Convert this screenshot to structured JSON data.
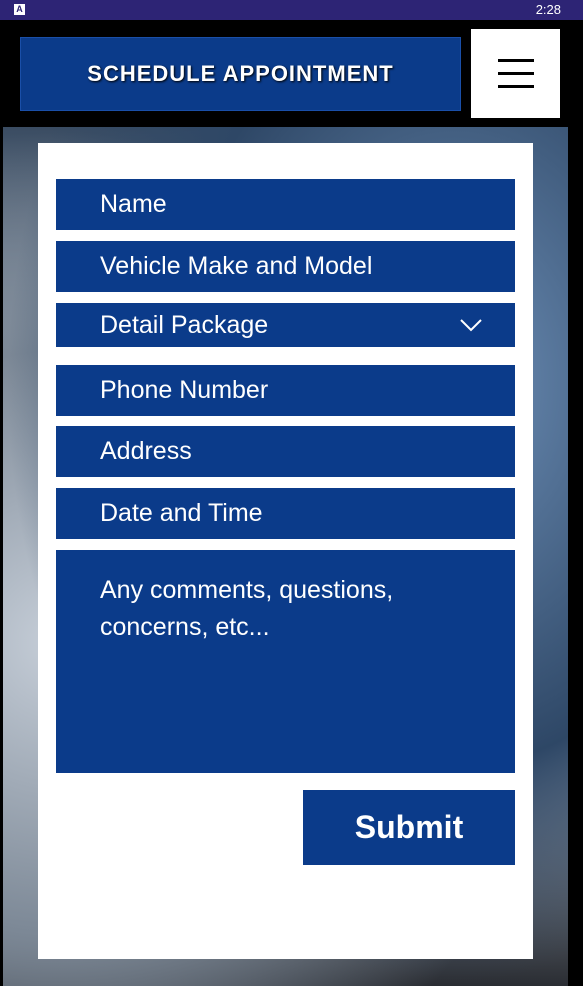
{
  "status_bar": {
    "app_badge": "A",
    "time": "2:28"
  },
  "header": {
    "title": "SCHEDULE APPOINTMENT"
  },
  "form": {
    "name_placeholder": "Name",
    "vehicle_placeholder": "Vehicle Make and Model",
    "package_placeholder": "Detail Package",
    "phone_placeholder": "Phone Number",
    "address_placeholder": "Address",
    "datetime_placeholder": "Date and Time",
    "comments_placeholder": "Any comments, questions, concerns, etc...",
    "submit_label": "Submit"
  },
  "colors": {
    "primary": "#0b3b8a",
    "status_bar": "#2d2475"
  }
}
